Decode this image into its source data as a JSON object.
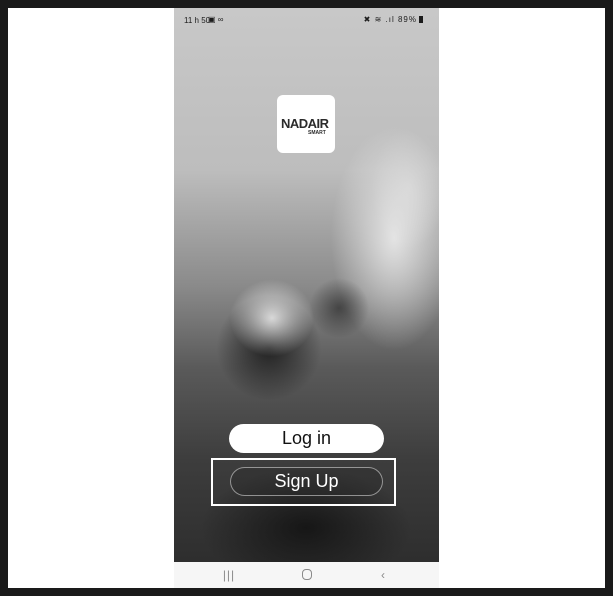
{
  "status_bar": {
    "time": "11 h 50",
    "left_icons": "▣ ∞",
    "right_icons": "✖ ≋ .ıl",
    "battery_text": "89%"
  },
  "app": {
    "logo_text": "NADAIR",
    "logo_subtext": "SMART"
  },
  "buttons": {
    "login_label": "Log in",
    "signup_label": "Sign Up"
  },
  "nav_bar": {
    "recents_icon": "|||",
    "back_icon": "‹"
  }
}
